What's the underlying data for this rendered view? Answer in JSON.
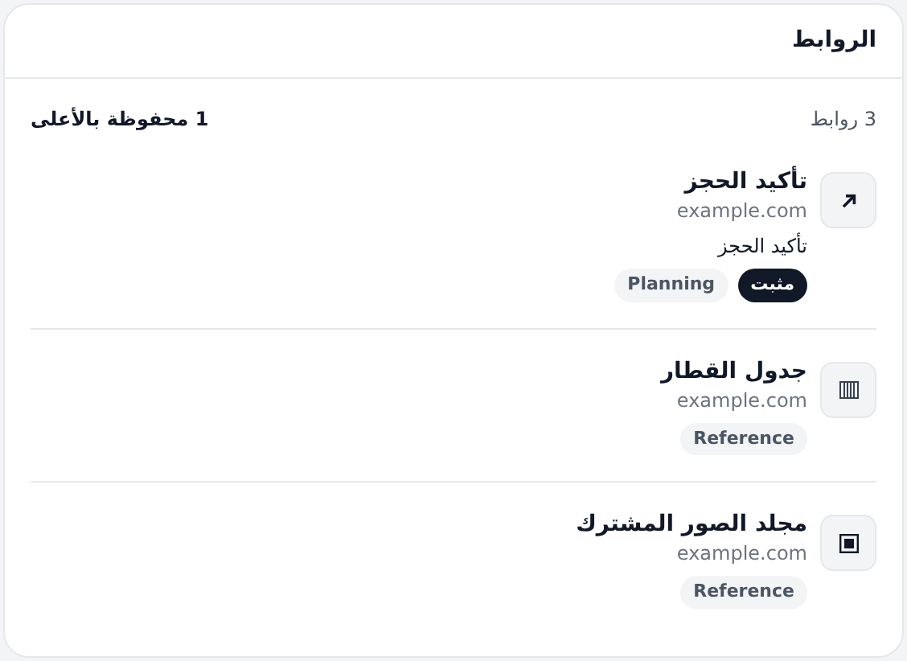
{
  "panel": {
    "title": "الروابط"
  },
  "summary": {
    "count": "3 روابط",
    "pinned": "1 محفوظة بالأعلى"
  },
  "links": [
    {
      "kind": "arrow",
      "title": "تأكيد الحجز",
      "domain": "example.com",
      "note": "تأكيد الحجز",
      "badges": [
        {
          "label": "مثبت",
          "kind": "pinned"
        },
        {
          "label": "Planning",
          "kind": "tag"
        }
      ]
    },
    {
      "kind": "columns",
      "title": "جدول القطار",
      "domain": "example.com",
      "badges": [
        {
          "label": "Reference",
          "kind": "tag"
        }
      ]
    },
    {
      "kind": "square",
      "title": "مجلد الصور المشترك",
      "domain": "example.com",
      "badges": [
        {
          "label": "Reference",
          "kind": "tag"
        }
      ]
    }
  ]
}
